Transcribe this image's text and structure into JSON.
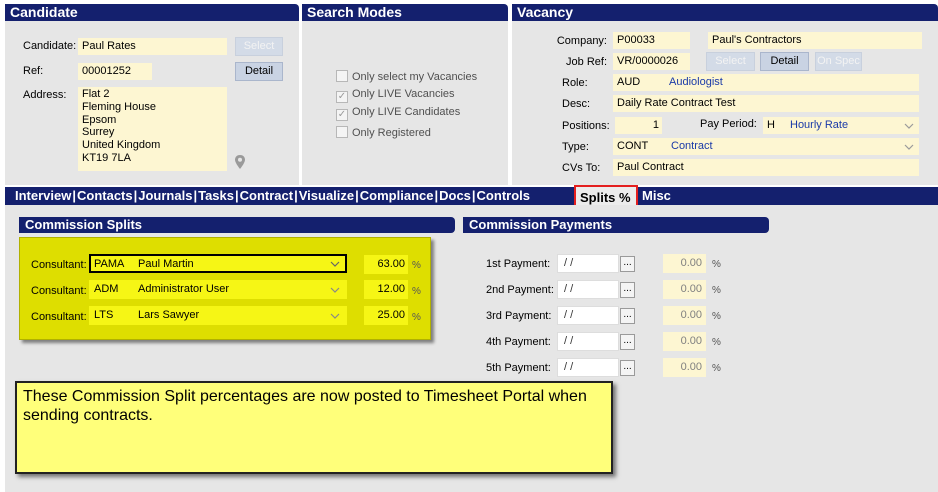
{
  "candidate": {
    "header": "Candidate",
    "candidate_label": "Candidate:",
    "candidate_value": "Paul Rates",
    "select_label": "Select",
    "ref_label": "Ref:",
    "ref_value": "00001252",
    "detail_label": "Detail",
    "address_label": "Address:",
    "address_lines": [
      "Flat 2",
      "Fleming House",
      "Epsom",
      "Surrey",
      "United Kingdom",
      "KT19 7LA"
    ]
  },
  "search_modes": {
    "header": "Search Modes",
    "options": [
      {
        "label": "Only select my Vacancies",
        "checked": false
      },
      {
        "label": "Only LIVE Vacancies",
        "checked": true
      },
      {
        "label": "Only LIVE Candidates",
        "checked": true
      },
      {
        "label": "Only Registered",
        "checked": false
      }
    ]
  },
  "vacancy": {
    "header": "Vacancy",
    "company_label": "Company:",
    "company_code": "P00033",
    "company_name": "Paul's Contractors",
    "jobref_label": "Job Ref:",
    "jobref_value": "VR/0000026",
    "select_label": "Select",
    "detail_label": "Detail",
    "onspec_label": "On Spec",
    "role_label": "Role:",
    "role_code": "AUD",
    "role_name": "Audiologist",
    "desc_label": "Desc:",
    "desc_value": "Daily Rate Contract Test",
    "positions_label": "Positions:",
    "positions_value": "1",
    "payperiod_label": "Pay Period:",
    "payperiod_code": "H",
    "payperiod_name": "Hourly Rate",
    "type_label": "Type:",
    "type_code": "CONT",
    "type_name": "Contract",
    "cvsto_label": "CVs To:",
    "cvsto_value": "Paul Contract"
  },
  "tabs": [
    "Interview",
    "Contacts",
    "Journals",
    "Tasks",
    "Contract",
    "Visualize",
    "Compliance",
    "Docs",
    "Controls",
    "Splits %",
    "Misc"
  ],
  "active_tab": "Splits %",
  "commission_splits": {
    "header": "Commission Splits",
    "rows": [
      {
        "label": "Consultant:",
        "code": "PAMA",
        "name": "Paul Martin",
        "pct": "63.00",
        "unit": "%"
      },
      {
        "label": "Consultant:",
        "code": "ADM",
        "name": "Administrator User",
        "pct": "12.00",
        "unit": "%"
      },
      {
        "label": "Consultant:",
        "code": "LTS",
        "name": "Lars Sawyer",
        "pct": "25.00",
        "unit": "%"
      }
    ]
  },
  "commission_payments": {
    "header": "Commission Payments",
    "rows": [
      {
        "label": "1st Payment:",
        "date": " /  /",
        "amount": "0.00",
        "unit": "%"
      },
      {
        "label": "2nd Payment:",
        "date": " /  /",
        "amount": "0.00",
        "unit": "%"
      },
      {
        "label": "3rd Payment:",
        "date": " /  /",
        "amount": "0.00",
        "unit": "%"
      },
      {
        "label": "4th Payment:",
        "date": " /  /",
        "amount": "0.00",
        "unit": "%"
      },
      {
        "label": "5th Payment:",
        "date": " /  /",
        "amount": "0.00",
        "unit": "%"
      }
    ],
    "dots_label": "..."
  },
  "note": "These Commission Split percentages are now posted to Timesheet Portal when sending contracts.",
  "icons": {
    "location": "map-pin-icon",
    "dropdown": "chevron-down-icon"
  }
}
